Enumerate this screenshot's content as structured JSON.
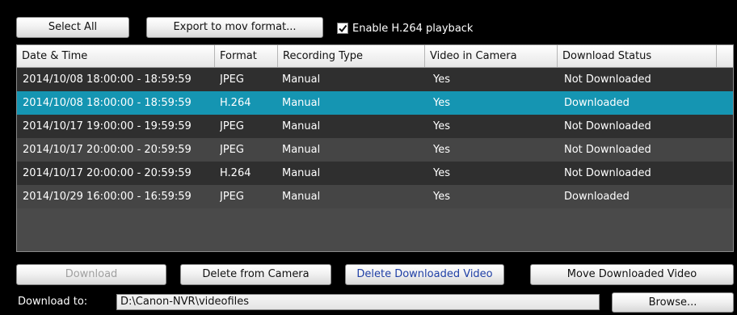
{
  "toolbar": {
    "select_all_label": "Select All",
    "export_label": "Export to mov format...",
    "enable_h264_label": "Enable H.264 playback",
    "enable_h264_checked": true
  },
  "table": {
    "columns": [
      "Date & Time",
      "Format",
      "Recording Type",
      "Video in Camera",
      "Download Status"
    ],
    "rows": [
      {
        "datetime": "2014/10/08 18:00:00 - 18:59:59",
        "format": "JPEG",
        "type": "Manual",
        "in_camera": "Yes",
        "status": "Not Downloaded"
      },
      {
        "datetime": "2014/10/08 18:00:00 - 18:59:59",
        "format": "H.264",
        "type": "Manual",
        "in_camera": "Yes",
        "status": "Downloaded"
      },
      {
        "datetime": "2014/10/17 19:00:00 - 19:59:59",
        "format": "JPEG",
        "type": "Manual",
        "in_camera": "Yes",
        "status": "Not Downloaded"
      },
      {
        "datetime": "2014/10/17 20:00:00 - 20:59:59",
        "format": "JPEG",
        "type": "Manual",
        "in_camera": "Yes",
        "status": "Not Downloaded"
      },
      {
        "datetime": "2014/10/17 20:00:00 - 20:59:59",
        "format": "H.264",
        "type": "Manual",
        "in_camera": "Yes",
        "status": "Not Downloaded"
      },
      {
        "datetime": "2014/10/29 16:00:00 - 16:59:59",
        "format": "JPEG",
        "type": "Manual",
        "in_camera": "Yes",
        "status": "Downloaded"
      }
    ],
    "selected_row": 1
  },
  "actions": {
    "download_label": "Download",
    "delete_from_camera_label": "Delete from Camera",
    "delete_downloaded_label": "Delete Downloaded Video",
    "move_downloaded_label": "Move Downloaded Video"
  },
  "download_to": {
    "label": "Download to:",
    "path": "D:\\Canon-NVR\\videofiles",
    "browse_label": "Browse..."
  },
  "colors": {
    "selected_row": "#1595b2",
    "background": "#000000",
    "delete_downloaded_text": "#1f3fa6"
  }
}
